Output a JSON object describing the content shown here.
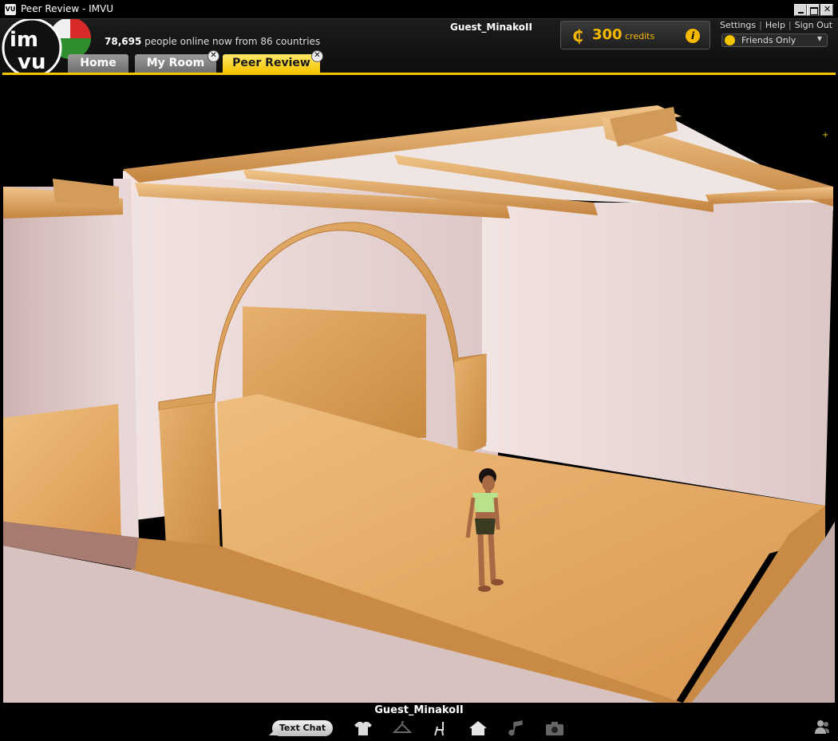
{
  "window": {
    "title": "Peer Review - IMVU",
    "icon_label": "VU"
  },
  "header": {
    "logo_text": "imvu",
    "online_count": "78,695",
    "online_text": " people online now from 86 countries",
    "username": "Guest_MinakoII",
    "credits": {
      "symbol": "₵",
      "amount": "300",
      "label": "credits"
    },
    "links": {
      "settings": "Settings",
      "help": "Help",
      "sign_out": "Sign Out"
    },
    "status_dropdown": "Friends Only"
  },
  "tabs": [
    {
      "label": "Home"
    },
    {
      "label": "My Room"
    },
    {
      "label": "Peer Review"
    }
  ],
  "bottom": {
    "username": "Guest_MinakoII",
    "text_chat_label": "Text Chat"
  },
  "colors": {
    "accent": "#f5c400",
    "credits": "#f5b800"
  }
}
